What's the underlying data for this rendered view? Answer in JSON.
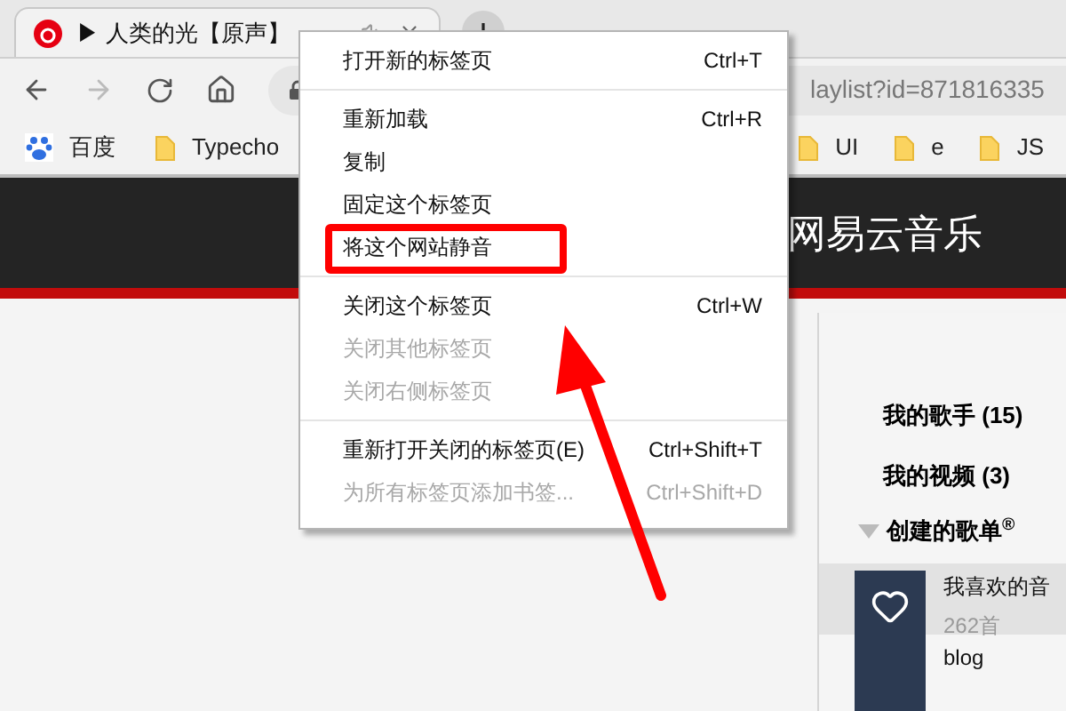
{
  "tab": {
    "title": "▶ 人类的光【原声】",
    "audio_playing": true
  },
  "address_bar": {
    "url": "laylist?id=871816335"
  },
  "bookmarks_left": [
    {
      "label": "百度",
      "kind": "site"
    },
    {
      "label": "Typecho",
      "kind": "folder"
    }
  ],
  "bookmarks_right": [
    {
      "label": "UI",
      "kind": "folder"
    },
    {
      "label": "e",
      "kind": "folder"
    },
    {
      "label": "JS",
      "kind": "folder"
    }
  ],
  "site_header": {
    "title": "网易云音乐"
  },
  "sidebar": {
    "items": [
      {
        "label": "我的歌手 (15)"
      },
      {
        "label": "我的视频 (3)"
      }
    ],
    "created_playlists": {
      "label": "创建的歌单$^{®}$",
      "expanded": true
    },
    "playlists": [
      {
        "name": "我喜欢的音",
        "count": "262首",
        "selected": true
      },
      {
        "name": "blog",
        "selected": false
      }
    ]
  },
  "context_menu": {
    "groups": [
      [
        {
          "label": "打开新的标签页",
          "shortcut": "Ctrl+T",
          "disabled": false,
          "marked": false
        }
      ],
      [
        {
          "label": "重新加载",
          "shortcut": "Ctrl+R",
          "disabled": false,
          "marked": false
        },
        {
          "label": "复制",
          "disabled": false,
          "marked": false
        },
        {
          "label": "固定这个标签页",
          "disabled": false,
          "marked": false
        },
        {
          "label": "将这个网站静音",
          "disabled": false,
          "marked": true
        }
      ],
      [
        {
          "label": "关闭这个标签页",
          "shortcut": "Ctrl+W",
          "disabled": false,
          "marked": false
        },
        {
          "label": "关闭其他标签页",
          "disabled": true,
          "marked": false
        },
        {
          "label": "关闭右侧标签页",
          "disabled": true,
          "marked": false
        }
      ],
      [
        {
          "label": "重新打开关闭的标签页(E)",
          "shortcut": "Ctrl+Shift+T",
          "disabled": false,
          "marked": false
        },
        {
          "label": "为所有标签页添加书签...",
          "shortcut": "Ctrl+Shift+D",
          "disabled": true,
          "marked": false
        }
      ]
    ]
  }
}
